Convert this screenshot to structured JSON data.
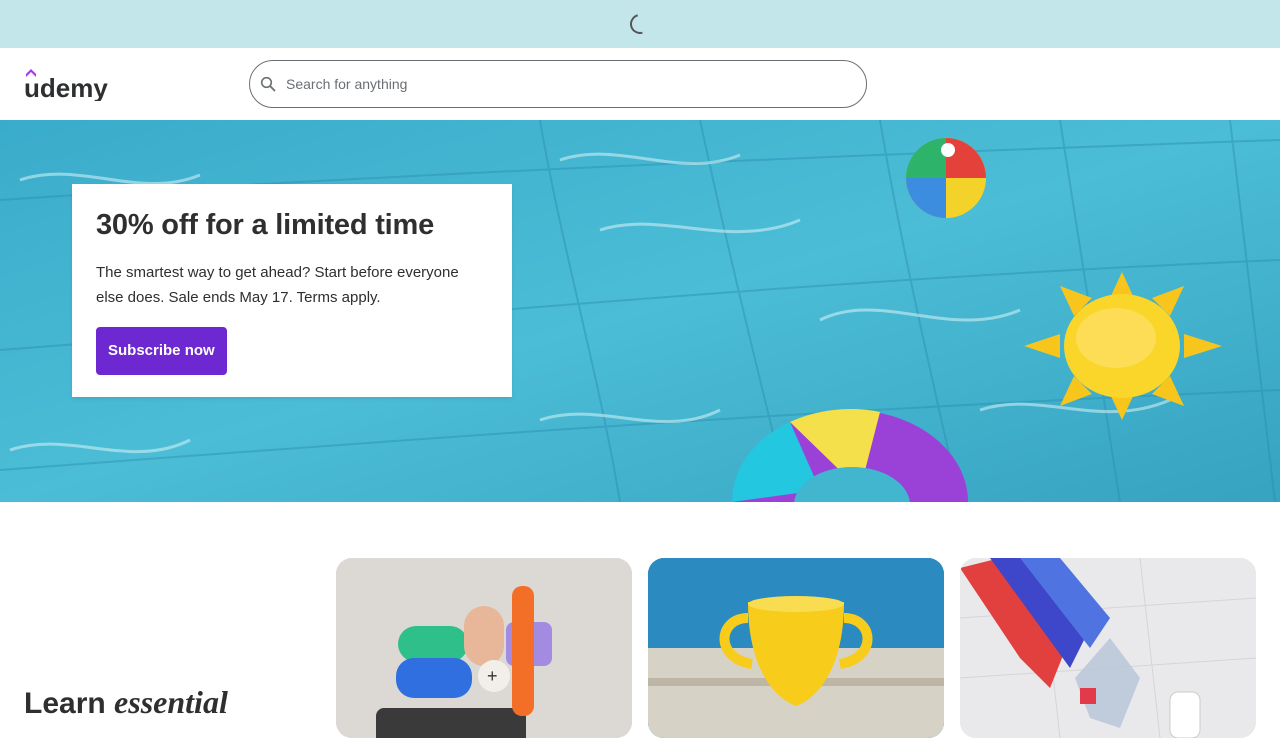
{
  "loading": {
    "icon": "spinner-icon"
  },
  "header": {
    "logo_text": "udemy",
    "search": {
      "placeholder": "Search for anything",
      "value": "",
      "icon": "search-icon"
    }
  },
  "hero": {
    "title": "30% off for a limited time",
    "description": "The smartest way to get ahead? Start before everyone else does. Sale ends May 17. Terms apply.",
    "cta_label": "Subscribe now"
  },
  "section": {
    "heading_plain": "Learn",
    "heading_emphasis": "essential"
  },
  "colors": {
    "accent": "#6d28d2",
    "loading_bar": "#c3e6ea",
    "text": "#2d2f31"
  }
}
